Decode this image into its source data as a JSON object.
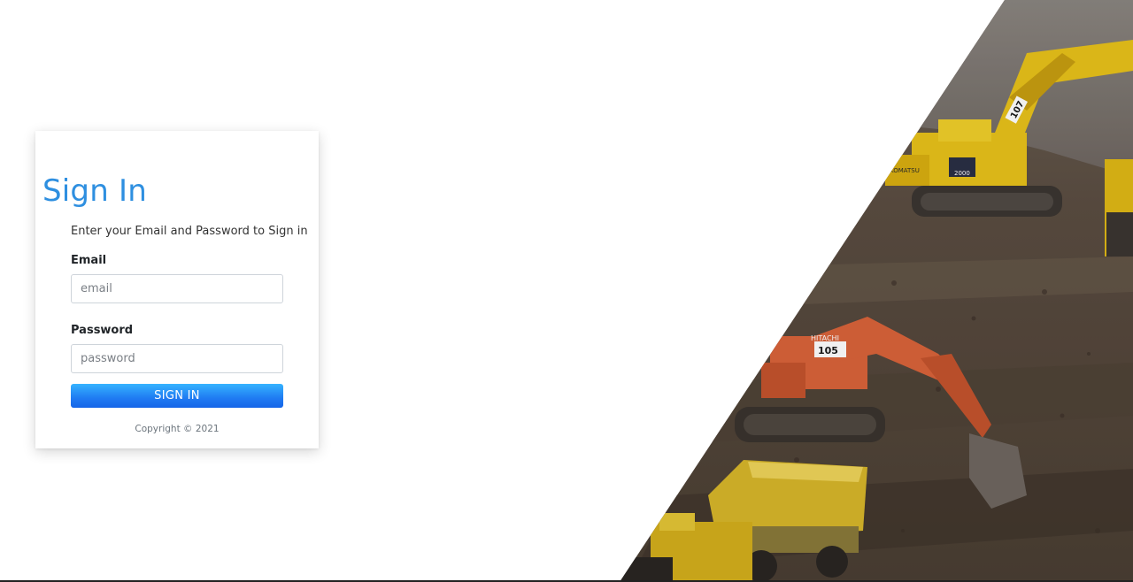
{
  "login": {
    "title": "Sign In",
    "subtitle": "Enter your Email and Password to Sign in",
    "email_label": "Email",
    "email_placeholder": "email",
    "email_value": "",
    "password_label": "Password",
    "password_placeholder": "password",
    "password_value": "",
    "submit_label": "SIGN IN",
    "copyright": "Copyright © 2021"
  },
  "hero": {
    "excavator_1_number": "107",
    "excavator_2_number": "105",
    "excavator_2_brand": "HITACHI",
    "excavator_1_brand": "KOMATSU",
    "excavator_1_model": "2000"
  },
  "colors": {
    "title_blue": "#2e8fe0",
    "button_blue": "#1f7bf2",
    "excavator_yellow": "#e8c21a",
    "excavator_orange": "#d9633a",
    "ground_brown": "#5a4c40"
  }
}
